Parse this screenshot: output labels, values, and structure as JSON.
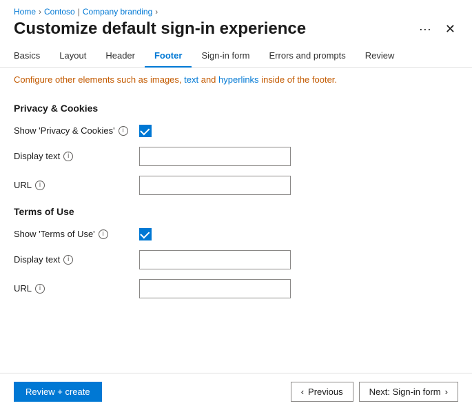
{
  "breadcrumb": {
    "items": [
      {
        "label": "Home",
        "href": "#"
      },
      {
        "label": "Contoso",
        "href": "#"
      },
      {
        "label": "Company branding",
        "href": "#"
      }
    ]
  },
  "header": {
    "title": "Customize default sign-in experience",
    "ellipsis_label": "···",
    "close_label": "✕"
  },
  "tabs": [
    {
      "id": "basics",
      "label": "Basics",
      "active": false
    },
    {
      "id": "layout",
      "label": "Layout",
      "active": false
    },
    {
      "id": "header",
      "label": "Header",
      "active": false
    },
    {
      "id": "footer",
      "label": "Footer",
      "active": true
    },
    {
      "id": "signin-form",
      "label": "Sign-in form",
      "active": false
    },
    {
      "id": "errors-prompts",
      "label": "Errors and prompts",
      "active": false
    },
    {
      "id": "review",
      "label": "Review",
      "active": false
    }
  ],
  "info_banner": {
    "text_before": "Configure other elements such as images, ",
    "link1": "text",
    "text_middle": " and ",
    "link2": "hyperlinks",
    "text_after": " inside of the footer."
  },
  "sections": [
    {
      "id": "privacy-cookies",
      "title": "Privacy & Cookies",
      "fields": [
        {
          "id": "show-privacy",
          "label": "Show 'Privacy & Cookies'",
          "type": "checkbox",
          "checked": true
        },
        {
          "id": "privacy-display-text",
          "label": "Display text",
          "type": "text",
          "value": "",
          "placeholder": ""
        },
        {
          "id": "privacy-url",
          "label": "URL",
          "type": "text",
          "value": "",
          "placeholder": ""
        }
      ]
    },
    {
      "id": "terms-of-use",
      "title": "Terms of Use",
      "fields": [
        {
          "id": "show-terms",
          "label": "Show 'Terms of Use'",
          "type": "checkbox",
          "checked": true
        },
        {
          "id": "terms-display-text",
          "label": "Display text",
          "type": "text",
          "value": "",
          "placeholder": ""
        },
        {
          "id": "terms-url",
          "label": "URL",
          "type": "text",
          "value": "",
          "placeholder": ""
        }
      ]
    }
  ],
  "footer": {
    "review_create_label": "Review + create",
    "previous_label": "Previous",
    "next_label": "Next: Sign-in form"
  }
}
